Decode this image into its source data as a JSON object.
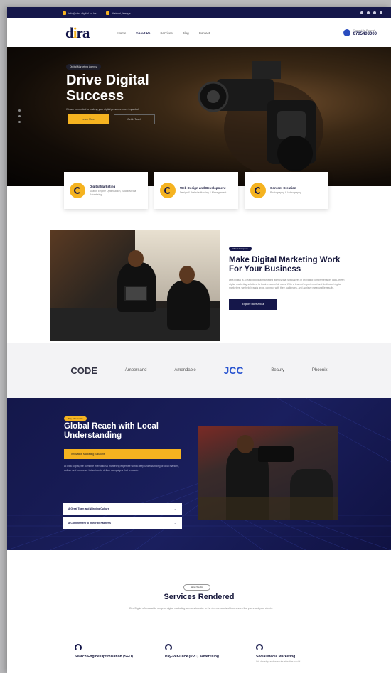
{
  "topbar": {
    "email": "info@dira.digital.co.ke",
    "address": "Nairobi, Kenya",
    "social_icons": [
      "facebook-icon",
      "instagram-icon",
      "twitter-icon",
      "linkedin-icon"
    ]
  },
  "nav": {
    "logo_d": "d",
    "logo_i": "i",
    "logo_ra": "ra",
    "items": [
      "Home",
      "About Us",
      "Services",
      "Blog",
      "Contact"
    ],
    "call_label": "Contact Us Support",
    "call_number": "0705403000"
  },
  "hero": {
    "pill": "Digital Marketing Agency",
    "title_line1": "Drive Digital",
    "title_line2": "Success",
    "subtitle": "We are committed to making your digital presence more impactful",
    "btn_primary": "Learn More",
    "btn_secondary": "Get In Touch"
  },
  "cards": [
    {
      "title": "Digital Marketing",
      "desc": "Search Engine Optimisation, Social Media Advertising"
    },
    {
      "title": "Web Design and Development",
      "desc": "Design & Website Hosting & Management"
    },
    {
      "title": "Content Creation",
      "desc": "Photography & Videography"
    }
  ],
  "about": {
    "tag": "About Company",
    "title": "Make Digital Marketing Work For Your Business",
    "body": "Dira Digital is a leading digital marketing agency that specializes in providing comprehensive, data-driven digital marketing solutions to businesses of all sizes. With a team of experienced and dedicated digital marketers, we help brands grow, connect with their audiences, and achieve measurable results.",
    "button": "Explore More About"
  },
  "logos": [
    "CODE",
    "Ampersand",
    "Amendable",
    "JCC",
    "Beauty",
    "Phoenix"
  ],
  "global": {
    "tag": "Why Choose Us",
    "title": "Global Reach with Local Understanding",
    "bar": "Innovative Marketing Solutions",
    "body": "At Dira Digital, we combine international marketing expertise with a deep understanding of local markets, culture and consumer behaviour to deliver campaigns that resonate.",
    "list": [
      "A Great Team and Winning Culture",
      "A Commitment to Integrity, Fairness"
    ]
  },
  "services": {
    "tag": "What We Do",
    "title": "Services Rendered",
    "intro": "Dira Digital offers a wide range of digital marketing services to cater to the diverse needs of businesses like yours and your clients.",
    "items": [
      {
        "title": "Search Engine Optimisation (SEO)",
        "desc": ""
      },
      {
        "title": "Pay-Per-Click (PPC) Advertising",
        "desc": ""
      },
      {
        "title": "Social Media Marketing",
        "desc": "We develop and execute effective social"
      }
    ]
  }
}
